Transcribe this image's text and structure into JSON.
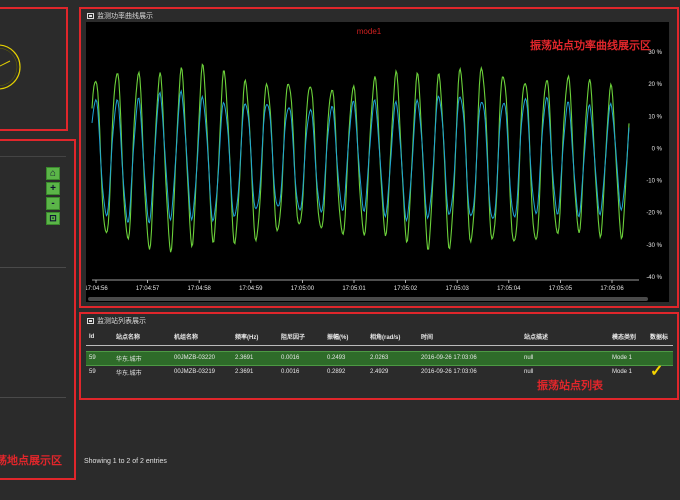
{
  "annotations": {
    "chart_region": "振荡站点功率曲线展示区",
    "table_region": "振荡站点列表",
    "map_region": "荡地点展示区"
  },
  "chart_panel": {
    "title": "监测功率曲线展示"
  },
  "table_panel": {
    "title": "监测站列表展示"
  },
  "map_panel": {
    "controls": [
      "home-icon",
      "zoom-in-icon",
      "zoom-out-icon",
      "select-area-icon"
    ]
  },
  "chart_data": {
    "type": "line",
    "title": "mode1",
    "x": [
      "17:04:56",
      "17:04:57",
      "17:04:58",
      "17:04:59",
      "17:05:00",
      "17:05:01",
      "17:05:02",
      "17:05:03",
      "17:05:04",
      "17:05:05",
      "17:05:06"
    ],
    "ylim": [
      -40,
      30
    ],
    "yticks": [
      "30 %",
      "20 %",
      "10 %",
      "0 %",
      "-10 %",
      "-20 %",
      "-30 %",
      "-40 %"
    ],
    "grid": false,
    "oscillation_cycles": 25,
    "series": [
      {
        "color": "#6cd13a",
        "amplitude": 27,
        "offset": -3
      },
      {
        "color": "#1fa3d6",
        "amplitude": 19,
        "offset": -3
      }
    ]
  },
  "table": {
    "headers": [
      "Id",
      "站点名称",
      "机组名称",
      "频率(Hz)",
      "阻尼因子",
      "振幅(%)",
      "相角(rad/s)",
      "时间",
      "站点描述",
      "模态类别",
      "数据标"
    ],
    "rows": [
      {
        "cells": [
          "59",
          "华东.城市",
          "00JMZB-03220",
          "2.3691",
          "0.0016",
          "0.2493",
          "2.0263",
          "2016-09-26 17:03:06",
          "null",
          "Mode 1",
          ""
        ],
        "selected": true
      },
      {
        "cells": [
          "59",
          "华东.城市",
          "00JMZB-03219",
          "2.3691",
          "0.0016",
          "0.2892",
          "2.4929",
          "2016-09-26 17:03:06",
          "null",
          "Mode 1",
          "✓"
        ],
        "selected": false
      }
    ],
    "info": "Showing 1 to 2 of 2 entries"
  },
  "colors": {
    "annotation_red": "#e0262b",
    "green_series": "#6cd13a",
    "blue_series": "#1fa3d6",
    "selected_row": "#2e6b29",
    "check": "#f5d400"
  }
}
